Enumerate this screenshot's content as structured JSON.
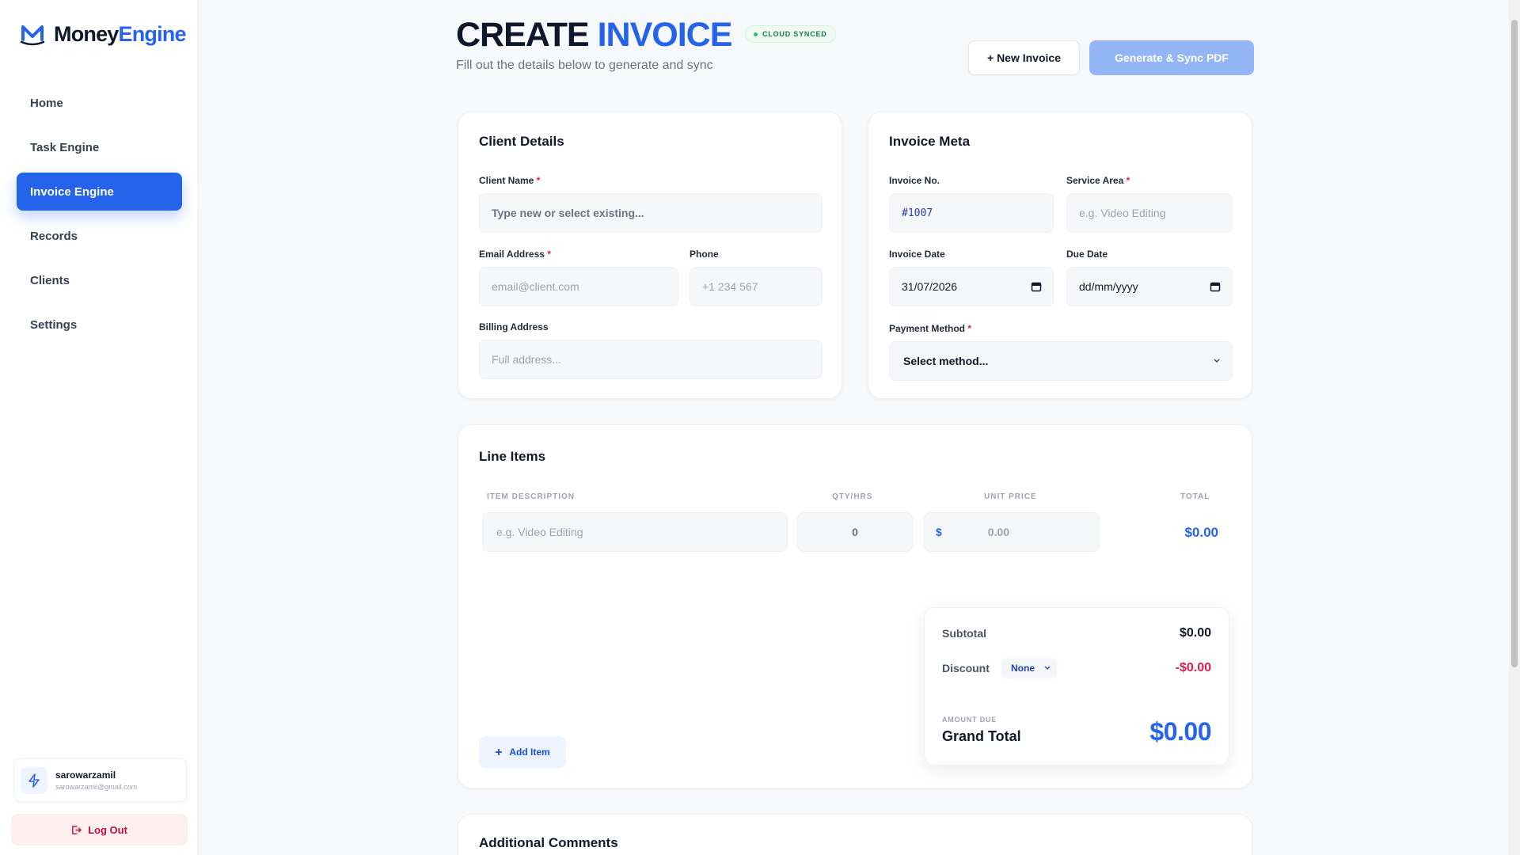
{
  "brand": {
    "name_part1": "Money",
    "name_part2": "Engine"
  },
  "sidebar": {
    "items": [
      {
        "label": "Home"
      },
      {
        "label": "Task Engine"
      },
      {
        "label": "Invoice Engine"
      },
      {
        "label": "Records"
      },
      {
        "label": "Clients"
      },
      {
        "label": "Settings"
      }
    ],
    "active_index": 2,
    "user": {
      "name": "sarowarzamil",
      "email": "sarowarzamil@gmail.com"
    },
    "logout_label": "Log Out"
  },
  "header": {
    "title_part1": "CREATE",
    "title_part2": "INVOICE",
    "badge": "CLOUD SYNCED",
    "subtitle": "Fill out the details below to generate and sync",
    "new_invoice_label": "+ New Invoice",
    "generate_label": "Generate & Sync PDF"
  },
  "client_details": {
    "title": "Client Details",
    "client_name_label": "Client Name",
    "client_name_placeholder": "Type new or select existing...",
    "email_label": "Email Address",
    "email_placeholder": "email@client.com",
    "phone_label": "Phone",
    "phone_placeholder": "+1 234 567",
    "billing_label": "Billing Address",
    "billing_placeholder": "Full address..."
  },
  "invoice_meta": {
    "title": "Invoice Meta",
    "invoice_no_label": "Invoice No.",
    "invoice_no_value": "#1007",
    "service_area_label": "Service Area",
    "service_area_placeholder": "e.g. Video Editing",
    "invoice_date_label": "Invoice Date",
    "invoice_date_value": "31/07/2026",
    "due_date_label": "Due Date",
    "due_date_value": "dd/mm/yyyy",
    "payment_method_label": "Payment Method",
    "payment_method_value": "Select method..."
  },
  "line_items": {
    "title": "Line Items",
    "columns": [
      "ITEM DESCRIPTION",
      "QTY/HRS",
      "UNIT PRICE",
      "TOTAL"
    ],
    "row": {
      "description_placeholder": "e.g. Video Editing",
      "qty_placeholder": "0",
      "currency": "$",
      "price_placeholder": "0.00",
      "total": "$0.00"
    },
    "add_item_label": "Add Item"
  },
  "summary": {
    "subtotal_label": "Subtotal",
    "subtotal_value": "$0.00",
    "discount_label": "Discount",
    "discount_option": "None",
    "discount_value": "-$0.00",
    "amount_due_label": "AMOUNT DUE",
    "grand_total_label": "Grand Total",
    "grand_total_value": "$0.00"
  },
  "comments": {
    "title": "Additional Comments"
  },
  "colors": {
    "accent": "#2563eb",
    "danger": "#e11d48",
    "success": "#22c55e"
  }
}
